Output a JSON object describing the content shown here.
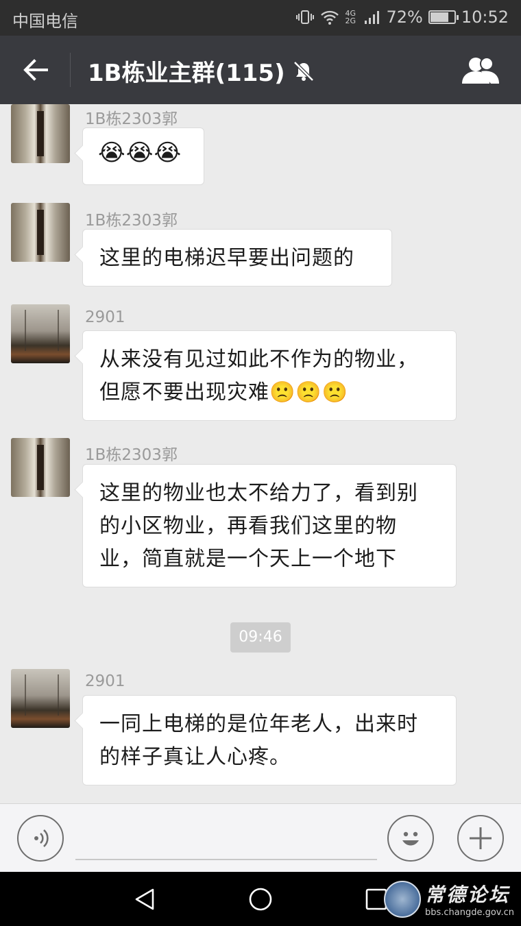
{
  "statusbar": {
    "carrier": "中国电信",
    "network": "4G 2G",
    "battery_percent": "72%",
    "battery_level": 0.72,
    "time": "10:52"
  },
  "header": {
    "title": "1B栋业主群(115)",
    "mute_icon": "bell-muted-icon",
    "back_icon": "arrow-left-icon",
    "group_icon": "group-members-icon"
  },
  "messages": [
    {
      "sender": "1B栋2303郭",
      "text_lines": [
        "😭😭😭"
      ]
    },
    {
      "sender": "1B栋2303郭",
      "text_lines": [
        "这里的电梯迟早要出问题的"
      ]
    },
    {
      "sender": "2901",
      "text_lines": [
        "从来没有见过如此不作为的物业，",
        "但愿不要出现灾难🙁🙁🙁"
      ]
    },
    {
      "sender": "1B栋2303郭",
      "text_lines": [
        "这里的物业也太不给力了，看到别",
        "的小区物业，再看我们这里的物",
        "业，简直就是一个天上一个地下"
      ]
    },
    {
      "sender": "2901",
      "text_lines": [
        "一同上电梯的是位年老人，出来时",
        "的样子真让人心疼。"
      ]
    }
  ],
  "timestamp": "09:46",
  "inputbar": {
    "voice_icon": "voice-icon",
    "emoji_icon": "emoji-icon",
    "plus_icon": "plus-icon"
  },
  "watermark": {
    "title": "常德论坛",
    "url": "bbs.changde.gov.cn"
  }
}
